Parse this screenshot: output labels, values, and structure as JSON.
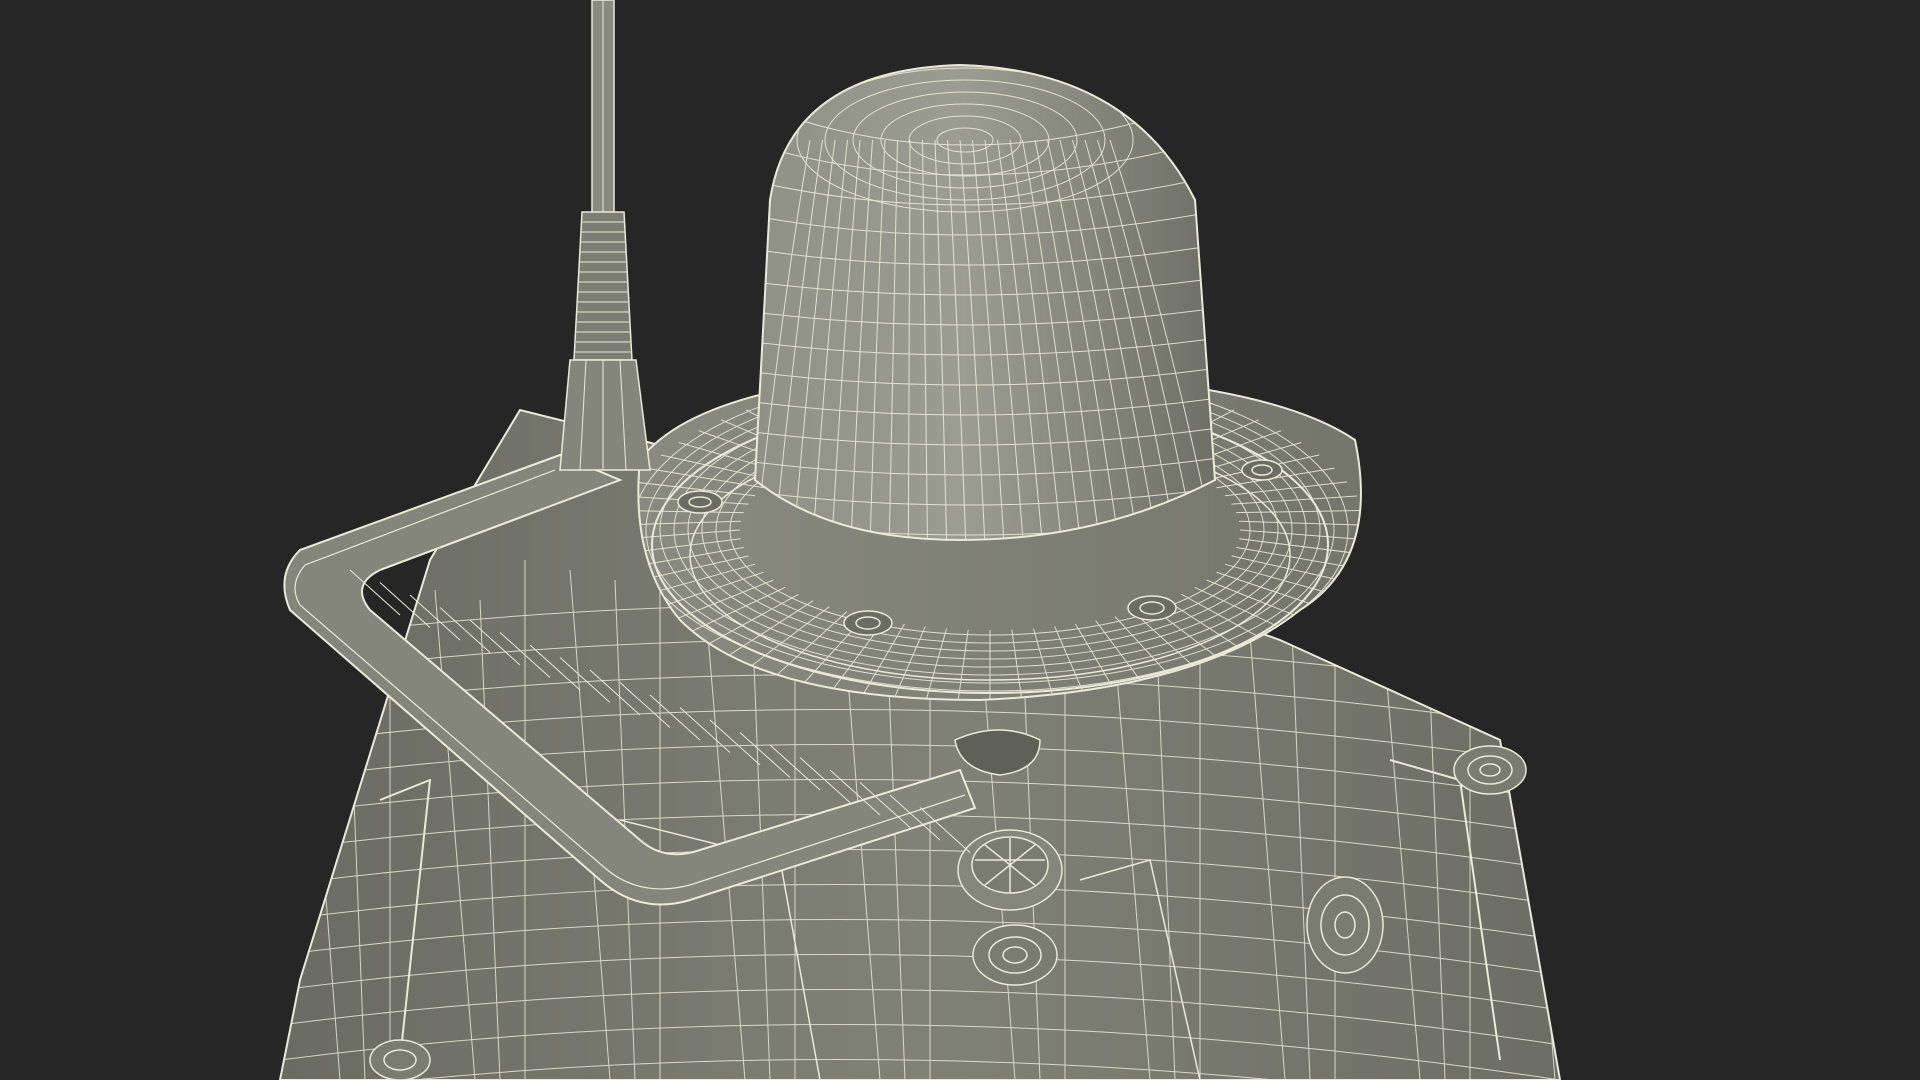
{
  "scene": {
    "kind": "3d-wireframe-render",
    "subject": "antenna-dome-device",
    "colors": {
      "background": "#262626",
      "surface": "#7c7d73",
      "surface_light": "#9a9b90",
      "surface_dark": "#5e5f56",
      "wire": "#e9ead8"
    },
    "parts": [
      "dome",
      "flange",
      "antenna",
      "handle",
      "body",
      "bolts",
      "knob"
    ]
  }
}
